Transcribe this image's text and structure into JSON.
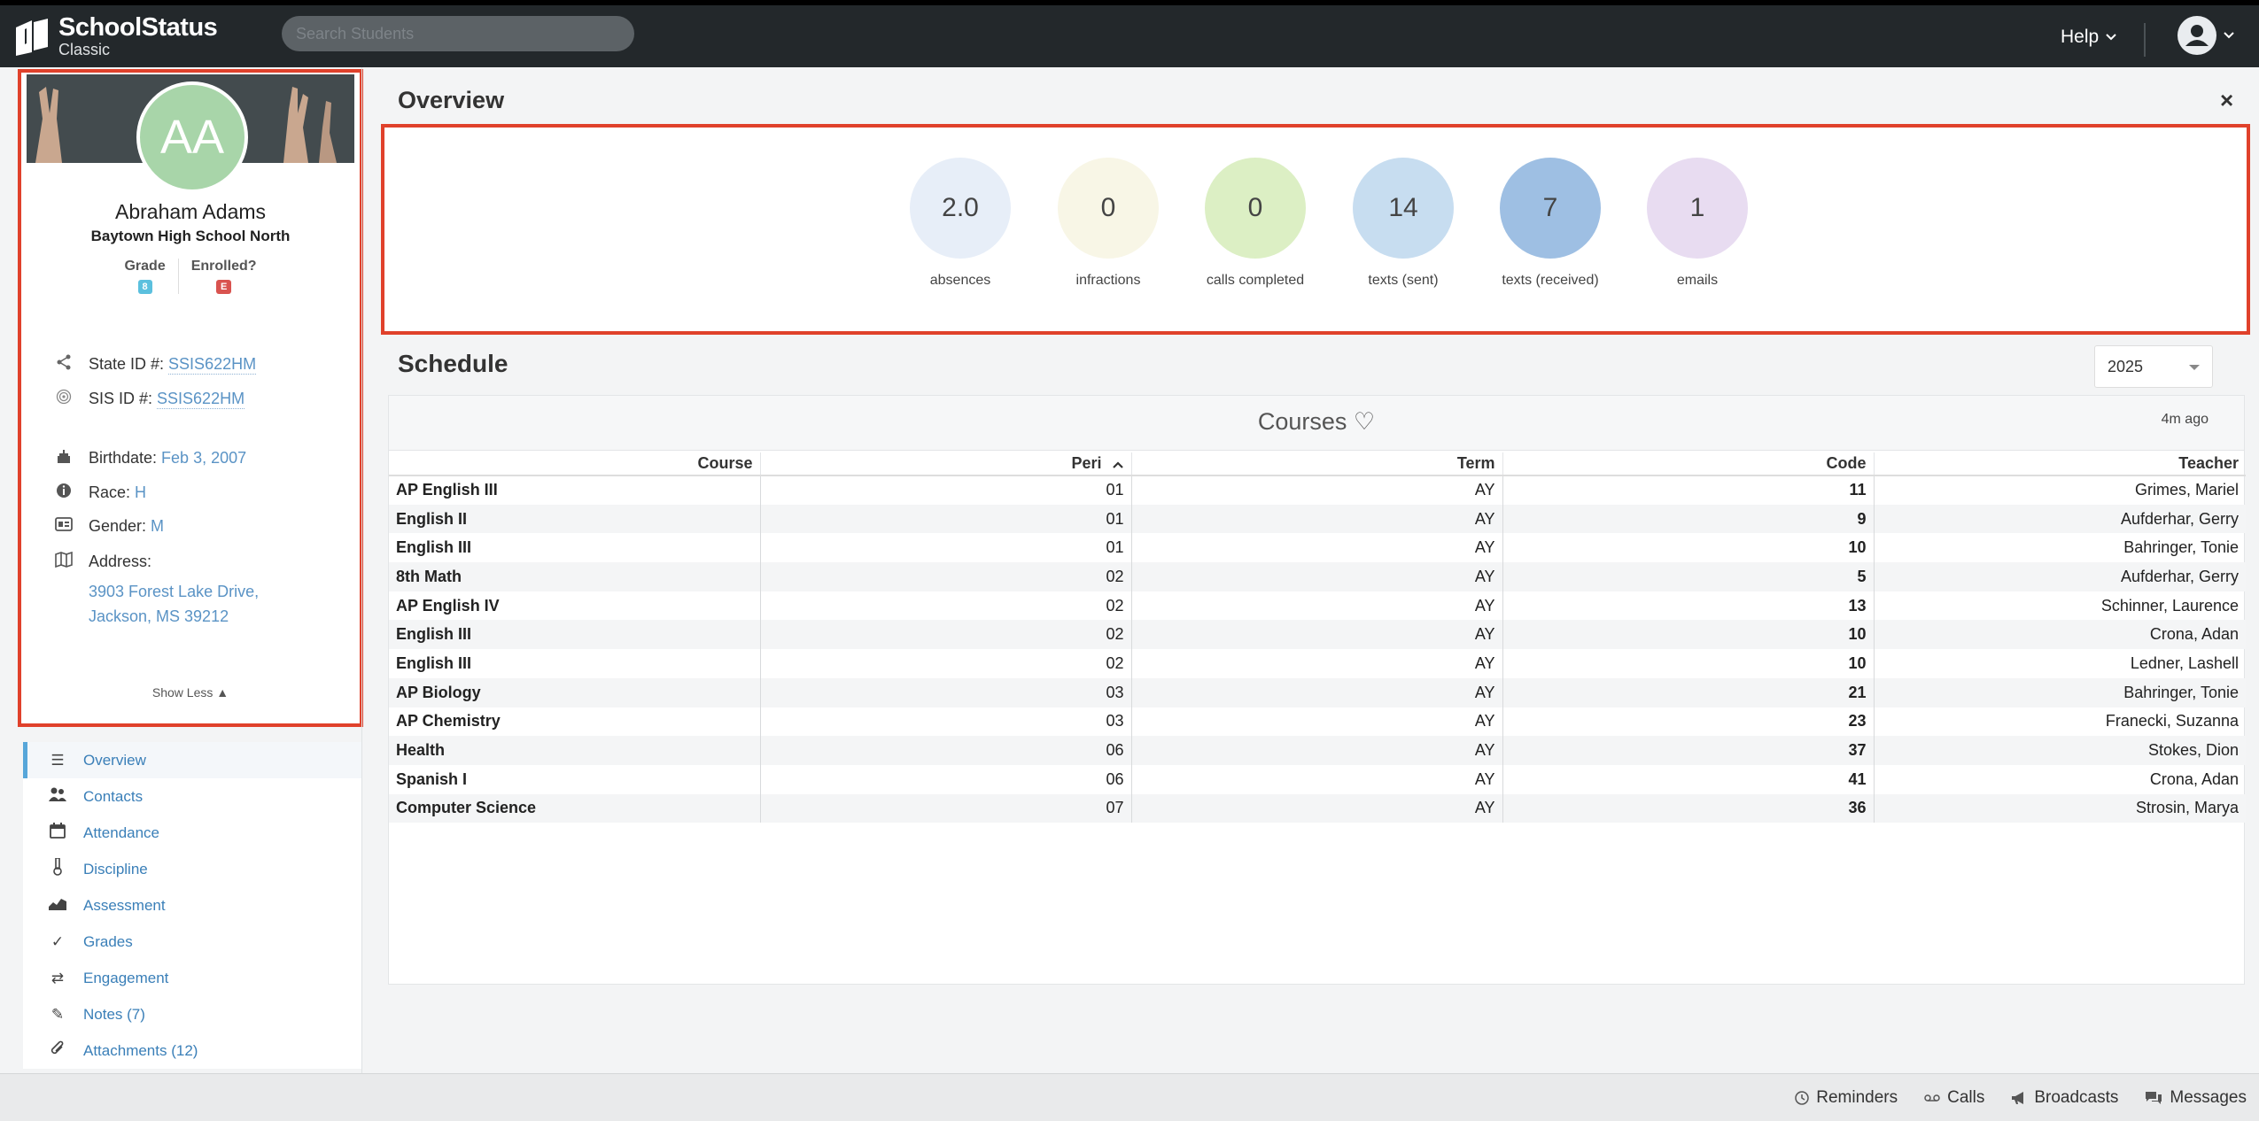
{
  "header": {
    "logo_title": "SchoolStatus",
    "logo_subtitle": "Classic",
    "search_placeholder": "Search Students",
    "help_label": "Help"
  },
  "profile": {
    "initials": "AA",
    "name": "Abraham Adams",
    "school": "Baytown High School North",
    "grade_label": "Grade",
    "grade_value": "8",
    "enrolled_label": "Enrolled?",
    "enrolled_value": "E",
    "state_id_label": "State ID #:",
    "state_id": "SSIS622HM",
    "sis_id_label": "SIS ID #:",
    "sis_id": "SSIS622HM",
    "birthdate_label": "Birthdate:",
    "birthdate": "Feb 3, 2007",
    "race_label": "Race:",
    "race": "H",
    "gender_label": "Gender:",
    "gender": "M",
    "address_label": "Address:",
    "address_line1": "3903 Forest Lake Drive,",
    "address_line2": "Jackson, MS 39212",
    "show_less": "Show Less ▲"
  },
  "menu": [
    {
      "label": "Overview",
      "icon": "list-icon"
    },
    {
      "label": "Contacts",
      "icon": "contacts-icon"
    },
    {
      "label": "Attendance",
      "icon": "calendar-icon"
    },
    {
      "label": "Discipline",
      "icon": "discipline-icon"
    },
    {
      "label": "Assessment",
      "icon": "chart-icon"
    },
    {
      "label": "Grades",
      "icon": "check-icon"
    },
    {
      "label": "Engagement",
      "icon": "exchange-icon"
    },
    {
      "label": "Notes (7)",
      "icon": "pencil-icon"
    },
    {
      "label": "Attachments (12)",
      "icon": "paperclip-icon"
    }
  ],
  "overview": {
    "title": "Overview",
    "close": "×",
    "stats": [
      {
        "value": "2.0",
        "label": "absences",
        "color": "#e7eef8"
      },
      {
        "value": "0",
        "label": "infractions",
        "color": "#f8f6e6"
      },
      {
        "value": "0",
        "label": "calls completed",
        "color": "#dcefc4"
      },
      {
        "value": "14",
        "label": "texts (sent)",
        "color": "#c7ddf0"
      },
      {
        "value": "7",
        "label": "texts (received)",
        "color": "#9ebfe3"
      },
      {
        "value": "1",
        "label": "emails",
        "color": "#e8dcf1"
      }
    ]
  },
  "schedule": {
    "title": "Schedule",
    "year": "2025",
    "courses_title": "Courses ♡",
    "updated": "4m ago",
    "columns": [
      "Course",
      "Peri",
      "Term",
      "Code",
      "Teacher"
    ],
    "rows": [
      [
        "AP English III",
        "01",
        "AY",
        "11",
        "Grimes, Mariel"
      ],
      [
        "English II",
        "01",
        "AY",
        "9",
        "Aufderhar, Gerry"
      ],
      [
        "English III",
        "01",
        "AY",
        "10",
        "Bahringer, Tonie"
      ],
      [
        "8th Math",
        "02",
        "AY",
        "5",
        "Aufderhar, Gerry"
      ],
      [
        "AP English IV",
        "02",
        "AY",
        "13",
        "Schinner, Laurence"
      ],
      [
        "English III",
        "02",
        "AY",
        "10",
        "Crona, Adan"
      ],
      [
        "English III",
        "02",
        "AY",
        "10",
        "Ledner, Lashell"
      ],
      [
        "AP Biology",
        "03",
        "AY",
        "21",
        "Bahringer, Tonie"
      ],
      [
        "AP Chemistry",
        "03",
        "AY",
        "23",
        "Franecki, Suzanna"
      ],
      [
        "Health",
        "06",
        "AY",
        "37",
        "Stokes, Dion"
      ],
      [
        "Spanish I",
        "06",
        "AY",
        "41",
        "Crona, Adan"
      ],
      [
        "Computer Science",
        "07",
        "AY",
        "36",
        "Strosin, Marya"
      ]
    ]
  },
  "footer": {
    "reminders": "Reminders",
    "calls": "Calls",
    "broadcasts": "Broadcasts",
    "messages": "Messages"
  }
}
